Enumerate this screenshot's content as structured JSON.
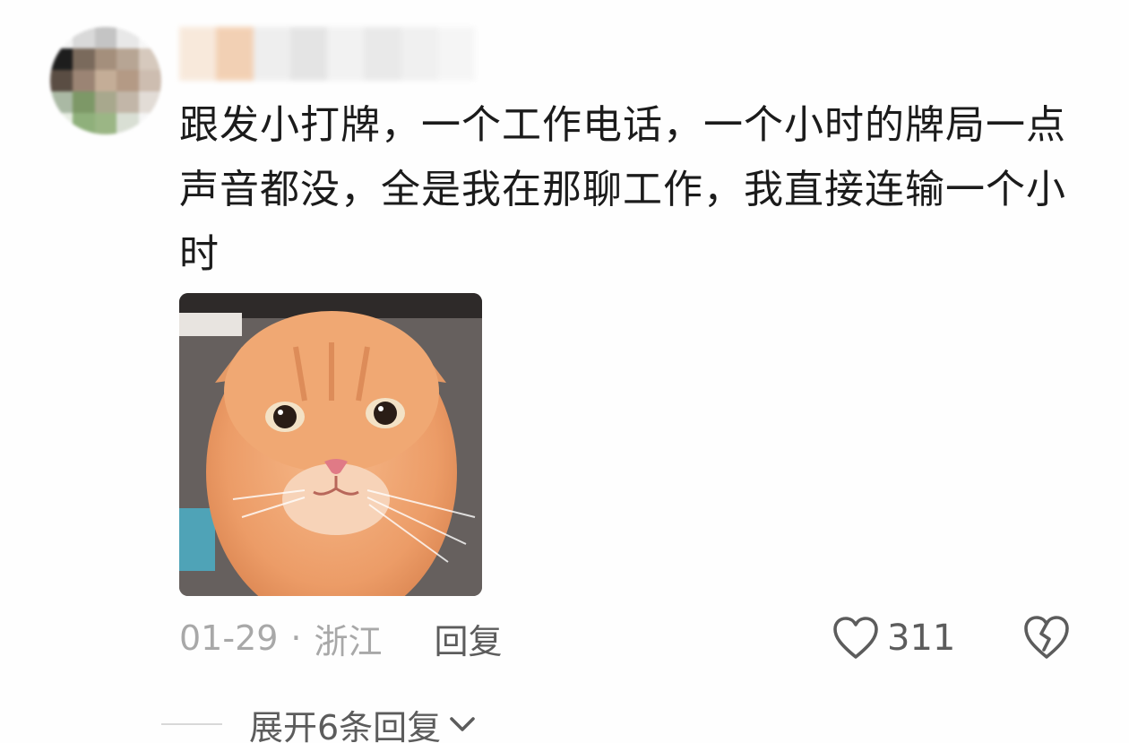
{
  "comment": {
    "text": "跟发小打牌，一个工作电话，一个小时的牌局一点声音都没，全是我在那聊工作，我直接连输一个小时",
    "date": "01-29",
    "separator": "·",
    "location": "浙江",
    "reply_label": "回复",
    "like_count": "311",
    "expand_label": "展开6条回复"
  },
  "icons": {
    "like": "heart-outline-icon",
    "dislike": "broken-heart-icon",
    "expand": "chevron-down-icon"
  },
  "colors": {
    "text": "#1b1b1b",
    "muted": "#a8a8a8",
    "action": "#5c5c5c"
  }
}
